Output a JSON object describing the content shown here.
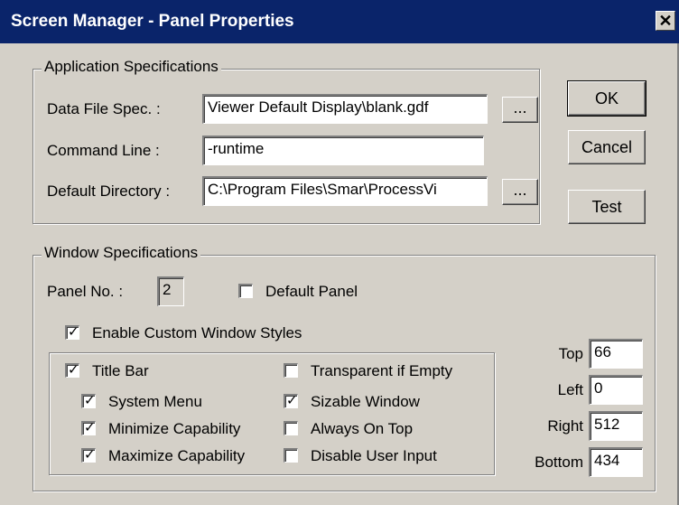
{
  "window": {
    "title": "Screen Manager - Panel Properties",
    "close_glyph": "✕"
  },
  "buttons": {
    "ok": "OK",
    "cancel": "Cancel",
    "test": "Test",
    "browse": "..."
  },
  "app_spec": {
    "legend": "Application Specifications",
    "data_file_label": "Data File Spec. :",
    "data_file_value": "Viewer Default Display\\blank.gdf",
    "command_line_label": "Command Line :",
    "command_line_value": "-runtime",
    "default_dir_label": "Default Directory :",
    "default_dir_value": "C:\\Program Files\\Smar\\ProcessVi"
  },
  "win_spec": {
    "legend": "Window Specifications",
    "panel_no_label": "Panel No. :",
    "panel_no_value": "2",
    "default_panel_label": "Default Panel",
    "default_panel_checked": false,
    "enable_custom_label": "Enable Custom Window Styles",
    "enable_custom_checked": true,
    "styles": {
      "title_bar": {
        "label": "Title Bar",
        "checked": true
      },
      "system_menu": {
        "label": "System Menu",
        "checked": true
      },
      "minimize": {
        "label": "Minimize Capability",
        "checked": true
      },
      "maximize": {
        "label": "Maximize Capability",
        "checked": true
      },
      "transparent": {
        "label": "Transparent if Empty",
        "checked": false
      },
      "sizable": {
        "label": "Sizable Window",
        "checked": true
      },
      "always_on_top": {
        "label": "Always On Top",
        "checked": false
      },
      "disable_input": {
        "label": "Disable User Input",
        "checked": false
      }
    },
    "pos": {
      "top_label": "Top",
      "top_value": "66",
      "left_label": "Left",
      "left_value": "0",
      "right_label": "Right",
      "right_value": "512",
      "bottom_label": "Bottom",
      "bottom_value": "434"
    }
  }
}
